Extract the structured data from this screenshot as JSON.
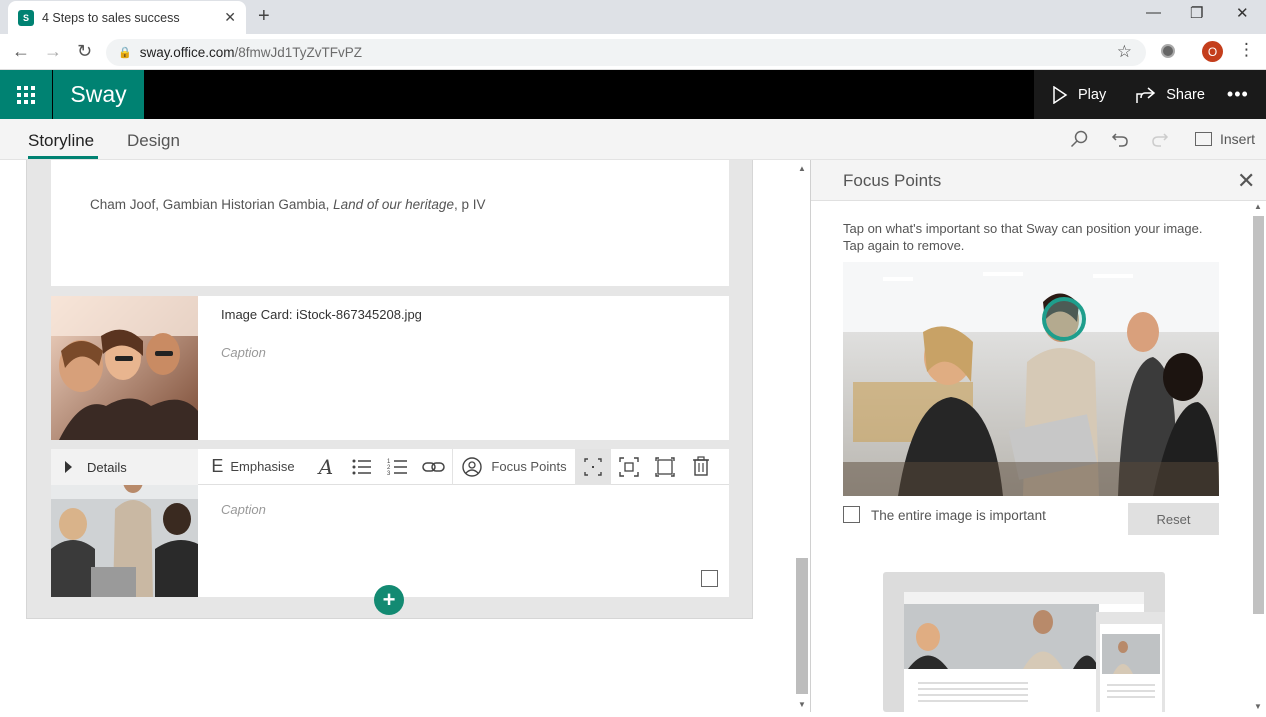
{
  "browser": {
    "tab_title": "4 Steps to sales success",
    "favicon_letter": "S",
    "url_host": "sway.office.com",
    "url_path": "/8fmwJd1TyZvTFvPZ",
    "profile_initial": "O"
  },
  "app": {
    "brand": "Sway",
    "actions": {
      "play": "Play",
      "share": "Share"
    }
  },
  "tabs": {
    "storyline": "Storyline",
    "design": "Design"
  },
  "toolbar": {
    "insert": "Insert"
  },
  "storyline": {
    "quote_prefix": "Cham Joof, Gambian Historian Gambia, ",
    "quote_title": "Land of our heritage",
    "quote_suffix": ", p IV",
    "card1": {
      "title": "Image Card: iStock-867345208.jpg",
      "caption_placeholder": "Caption"
    },
    "card2": {
      "details": "Details",
      "emphasise": "Emphasise",
      "focus_points": "Focus Points",
      "caption_placeholder": "Caption"
    }
  },
  "panel": {
    "title": "Focus Points",
    "description": "Tap on what's important so that Sway can position your image. Tap again to remove.",
    "entire_image_label": "The entire image is important",
    "reset": "Reset"
  },
  "colors": {
    "accent": "#008272",
    "header_bg": "#000000"
  }
}
